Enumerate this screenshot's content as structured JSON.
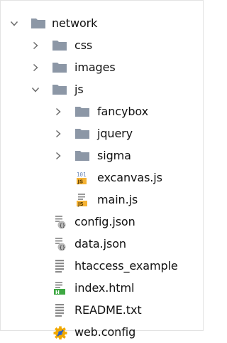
{
  "tree": {
    "items": [
      {
        "label": "network",
        "icon": "folder-icon",
        "chevron": "chevron-down-icon",
        "expanded": true
      },
      {
        "label": "css",
        "icon": "folder-icon",
        "chevron": "chevron-right-icon",
        "expanded": false
      },
      {
        "label": "images",
        "icon": "folder-icon",
        "chevron": "chevron-right-icon",
        "expanded": false
      },
      {
        "label": "js",
        "icon": "folder-icon",
        "chevron": "chevron-down-icon",
        "expanded": true
      },
      {
        "label": "fancybox",
        "icon": "folder-icon",
        "chevron": "chevron-right-icon",
        "expanded": false
      },
      {
        "label": "jquery",
        "icon": "folder-icon",
        "chevron": "chevron-right-icon",
        "expanded": false
      },
      {
        "label": "sigma",
        "icon": "folder-icon",
        "chevron": "chevron-right-icon",
        "expanded": false
      },
      {
        "label": "excanvas.js",
        "icon": "minified-js-file-icon"
      },
      {
        "label": "main.js",
        "icon": "js-file-icon"
      },
      {
        "label": "config.json",
        "icon": "json-file-icon"
      },
      {
        "label": "data.json",
        "icon": "json-file-icon"
      },
      {
        "label": "htaccess_example",
        "icon": "text-file-icon"
      },
      {
        "label": "index.html",
        "icon": "html-file-icon"
      },
      {
        "label": "README.txt",
        "icon": "text-file-icon"
      },
      {
        "label": "web.config",
        "icon": "config-gear-file-icon"
      }
    ]
  },
  "colors": {
    "folder": "#8c97a6",
    "chevron": "#6c6c6c",
    "js_badge": "#f5b335",
    "html_badge": "#3ea843",
    "gear": "#f0a800"
  }
}
